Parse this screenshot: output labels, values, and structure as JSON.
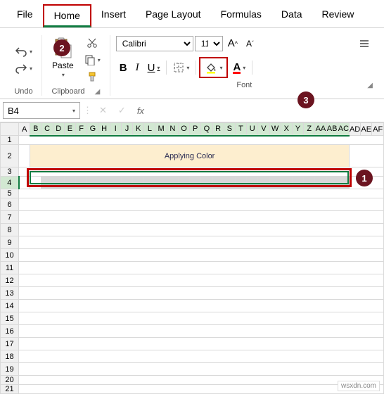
{
  "tabs": {
    "file": "File",
    "home": "Home",
    "insert": "Insert",
    "page_layout": "Page Layout",
    "formulas": "Formulas",
    "data": "Data",
    "review": "Review"
  },
  "ribbon": {
    "undo": {
      "label": "Undo"
    },
    "clipboard": {
      "label": "Clipboard",
      "paste": "Paste"
    },
    "font": {
      "label": "Font",
      "name": "Calibri",
      "size": "11",
      "bold": "B",
      "italic": "I",
      "underline": "U",
      "font_color_sample": "A",
      "increase": "A",
      "decrease": "A"
    }
  },
  "namebox": {
    "value": "B4"
  },
  "formula_bar": {
    "fx": "fx",
    "value": ""
  },
  "columns": [
    "A",
    "B",
    "C",
    "D",
    "E",
    "F",
    "G",
    "H",
    "I",
    "J",
    "K",
    "L",
    "M",
    "N",
    "O",
    "P",
    "Q",
    "R",
    "S",
    "T",
    "U",
    "V",
    "W",
    "X",
    "Y",
    "Z",
    "AA",
    "AB",
    "AC",
    "AD",
    "AE",
    "AF"
  ],
  "rows": [
    "1",
    "2",
    "3",
    "4",
    "5",
    "6",
    "7",
    "8",
    "9",
    "10",
    "11",
    "12",
    "13",
    "14",
    "15",
    "16",
    "17",
    "18",
    "19",
    "20",
    "21"
  ],
  "sheet": {
    "title_cell": "Applying Color"
  },
  "annotations": {
    "step1": "1",
    "step2": "2",
    "step3": "3"
  },
  "watermark": "wsxdn.com"
}
